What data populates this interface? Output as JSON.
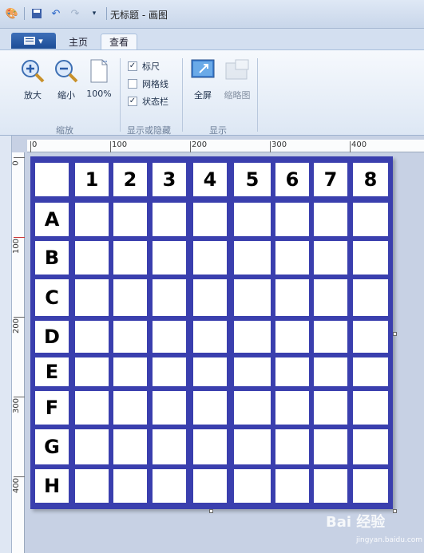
{
  "window": {
    "title": "无标题 - 画图"
  },
  "tabs": {
    "file_label": "▾",
    "home": "主页",
    "view": "查看"
  },
  "zoom": {
    "zoom_in": "放大",
    "zoom_out": "缩小",
    "percent": "100%",
    "group": "缩放"
  },
  "showhide": {
    "ruler": "标尺",
    "gridlines": "网格线",
    "statusbar": "状态栏",
    "group": "显示或隐藏",
    "ruler_checked": true,
    "gridlines_checked": false,
    "statusbar_checked": true
  },
  "display": {
    "fullscreen": "全屏",
    "thumbnail": "缩略图",
    "group": "显示"
  },
  "ruler": {
    "h": [
      "0",
      "100",
      "200",
      "300",
      "400"
    ],
    "v": [
      "0",
      "100",
      "200",
      "300",
      "400"
    ]
  },
  "grid": {
    "columns": [
      "1",
      "2",
      "3",
      "4",
      "5",
      "6",
      "7",
      "8"
    ],
    "rows": [
      "A",
      "B",
      "C",
      "D",
      "E",
      "F",
      "G",
      "H"
    ]
  },
  "watermark": {
    "brand": "Bai 经验",
    "url": "jingyan.baidu.com"
  }
}
